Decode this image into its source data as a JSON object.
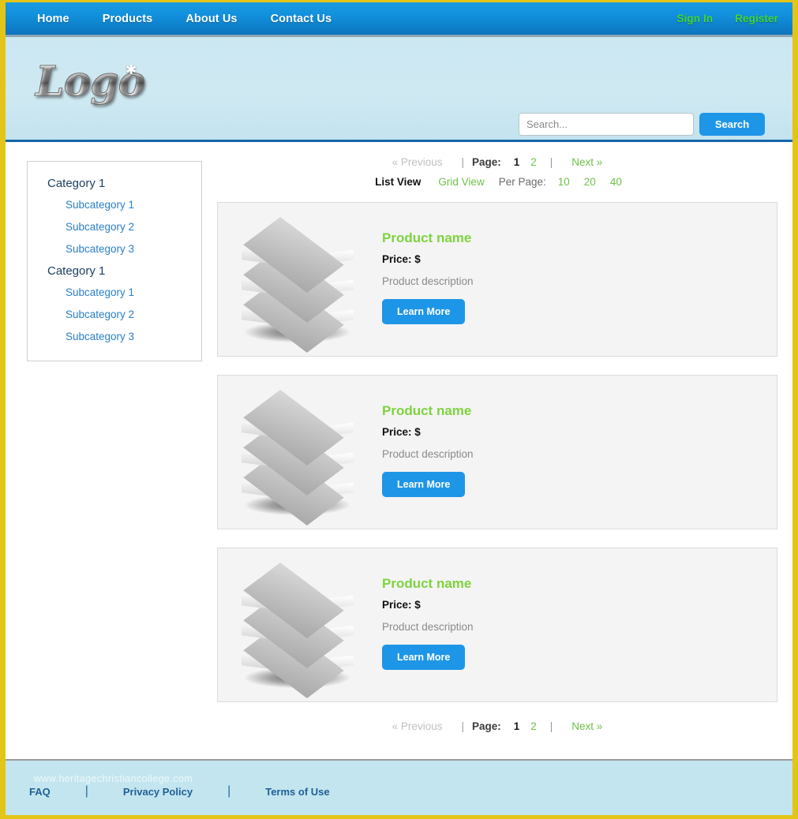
{
  "topnav": {
    "items": [
      {
        "label": "Home"
      },
      {
        "label": "Products"
      },
      {
        "label": "About Us"
      },
      {
        "label": "Contact Us"
      }
    ],
    "account": [
      {
        "label": "Sign In"
      },
      {
        "label": "Register"
      }
    ],
    "accent_color": "#44d62c",
    "background_color": "#1292de"
  },
  "banner": {
    "logo_text": "Logo",
    "logo_sparkle": "sparkle-icon",
    "background_color": "#cfe9f2",
    "search": {
      "value": "",
      "placeholder": "Search...",
      "button_label": "Search",
      "button_color": "#1e96e8"
    }
  },
  "sidebar": {
    "groups": [
      {
        "label": "Category 1",
        "items": [
          {
            "label": "Subcategory 1"
          },
          {
            "label": "Subcategory 2"
          },
          {
            "label": "Subcategory 3"
          }
        ]
      },
      {
        "label": "Category 1",
        "items": [
          {
            "label": "Subcategory 1"
          },
          {
            "label": "Subcategory 2"
          },
          {
            "label": "Subcategory 3"
          }
        ]
      }
    ],
    "link_color": "#2a7fc9"
  },
  "pagination": {
    "previous_label": "« Previous",
    "page_label": "Page:",
    "current_page": "1",
    "other_page": "2",
    "next_label": "Next »",
    "separator": "|",
    "active_color": "#1a1a1a",
    "link_color": "#6cc24a",
    "disabled_color": "#c0c0c0"
  },
  "viewbar": {
    "list_view_label": "List View",
    "grid_view_label": "Grid View",
    "per_page_label": "Per Page:",
    "per_page_options": [
      {
        "label": "10"
      },
      {
        "label": "20"
      },
      {
        "label": "40"
      }
    ],
    "active_view": "List View"
  },
  "products": [
    {
      "name": "Product name",
      "price": "Price: $",
      "description": "Product description",
      "button_label": "Learn More",
      "image": "stacked-boxes-icon"
    },
    {
      "name": "Product name",
      "price": "Price: $",
      "description": "Product description",
      "button_label": "Learn More",
      "image": "stacked-boxes-icon"
    },
    {
      "name": "Product name",
      "price": "Price: $",
      "description": "Product description",
      "button_label": "Learn More",
      "image": "stacked-boxes-icon"
    }
  ],
  "footer": {
    "links": [
      {
        "label": "FAQ"
      },
      {
        "label": "Privacy Policy"
      },
      {
        "label": "Terms of Use"
      }
    ],
    "separator": "|",
    "watermark": "www.heritagechristiancollege.com",
    "background_color": "#c3e5ef"
  },
  "theme": {
    "frame_color": "#e3c517",
    "product_name_color": "#7ed33f"
  }
}
